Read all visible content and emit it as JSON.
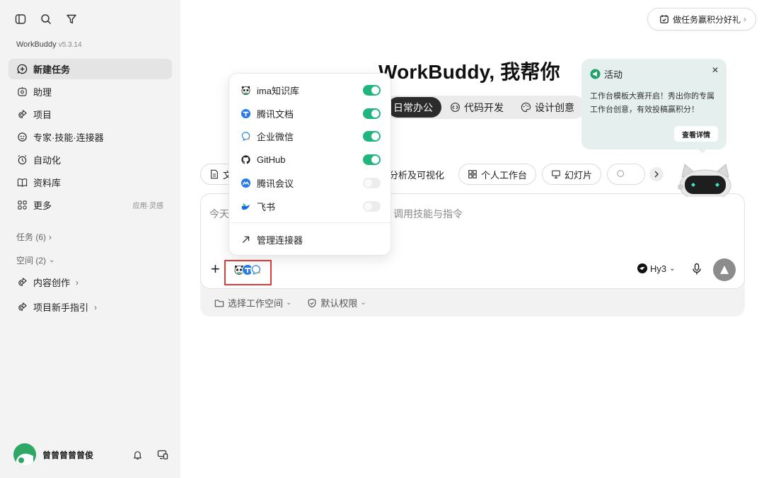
{
  "app": {
    "name": "WorkBuddy",
    "version": "v5.3.14"
  },
  "sidebar": {
    "top_icons": [
      "sidebar-toggle-icon",
      "search-icon",
      "filter-icon"
    ],
    "nav": [
      {
        "label": "新建任务",
        "icon": "add-task-icon",
        "active": true
      },
      {
        "label": "助理",
        "icon": "assistant-icon"
      },
      {
        "label": "项目",
        "icon": "project-icon"
      },
      {
        "label": "专家·技能·连接器",
        "icon": "expert-icon"
      },
      {
        "label": "自动化",
        "icon": "automation-icon"
      },
      {
        "label": "资料库",
        "icon": "library-icon"
      },
      {
        "label": "更多",
        "icon": "more-icon",
        "right": "应用·灵感"
      }
    ],
    "tasks_group": "任务 (6)",
    "spaces_group": "空间 (2)",
    "spaces": [
      {
        "label": "内容创作"
      },
      {
        "label": "项目新手指引"
      }
    ],
    "user": {
      "name": "曾曾曾曾曾俊"
    }
  },
  "header": {
    "reward_label": "做任务赢积分好礼"
  },
  "hero": {
    "title": "WorkBuddy, 我帮你"
  },
  "mode_tabs": [
    {
      "label": "日常办公",
      "active": true
    },
    {
      "label": "代码开发"
    },
    {
      "label": "设计创意"
    }
  ],
  "chips": {
    "first_partial": "文",
    "items": [
      "分析及可视化",
      "个人工作台",
      "幻灯片"
    ],
    "last_partial": ""
  },
  "composer": {
    "placeholder_left": "今天",
    "placeholder_right": "调用技能与指令",
    "model": "Hy3",
    "workspace_label": "选择工作空间",
    "permission_label": "默认权限"
  },
  "activity": {
    "title": "活动",
    "body": "工作台模板大赛开启！秀出你的专属工作台创意，有效投稿赢积分！",
    "button": "查看详情"
  },
  "connectors_menu": {
    "items": [
      {
        "label": "ima知识库",
        "icon": "ima-icon",
        "enabled": true
      },
      {
        "label": "腾讯文档",
        "icon": "tencent-docs-icon",
        "enabled": true
      },
      {
        "label": "企业微信",
        "icon": "wecom-icon",
        "enabled": true
      },
      {
        "label": "GitHub",
        "icon": "github-icon",
        "enabled": true
      },
      {
        "label": "腾讯会议",
        "icon": "tencent-meeting-icon",
        "enabled": false
      },
      {
        "label": "飞书",
        "icon": "feishu-icon",
        "enabled": false
      }
    ],
    "manage_label": "管理连接器"
  },
  "colors": {
    "accent_green": "#1fb57b",
    "highlight_red": "#e23b3b",
    "activity_bg": "#e5efee"
  }
}
